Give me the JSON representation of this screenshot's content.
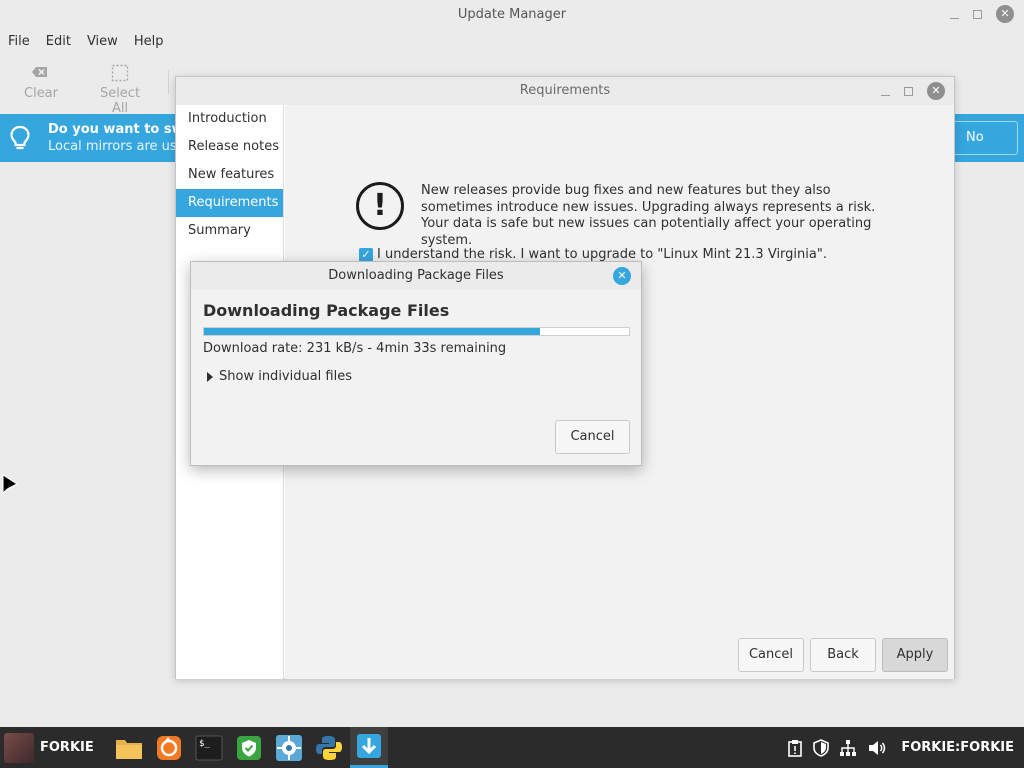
{
  "main_window": {
    "title": "Update Manager",
    "menu": [
      "File",
      "Edit",
      "View",
      "Help"
    ],
    "toolbar": {
      "clear_label": "Clear",
      "select_all_label": "Select All"
    },
    "infobar": {
      "title": "Do you want to switc",
      "subtitle": "Local mirrors are usua",
      "no_label": "No"
    }
  },
  "requirements_window": {
    "title": "Requirements",
    "sidebar": [
      "Introduction",
      "Release notes",
      "New features",
      "Requirements",
      "Summary"
    ],
    "active_sidebar_index": 3,
    "message": "New releases provide bug fixes and new features but they also sometimes introduce new issues. Upgrading always represents a risk. Your data is safe but new issues can potentially affect your operating system.",
    "checkbox_label": "I understand the risk. I want to upgrade to \"Linux Mint 21.3 Virginia\".",
    "checkbox_checked": true,
    "buttons": {
      "cancel": "Cancel",
      "back": "Back",
      "apply": "Apply"
    }
  },
  "download_dialog": {
    "title": "Downloading Package Files",
    "heading": "Downloading Package Files",
    "progress_fraction": 0.79,
    "rate_text": "Download rate: 231 kB/s - 4min 33s remaining",
    "expander_label": "Show individual files",
    "cancel_label": "Cancel"
  },
  "taskbar": {
    "menu_label": "FORKIE",
    "launchers": [
      "files-icon",
      "firefox-icon",
      "terminal-icon",
      "shield-app-icon",
      "network-app-icon",
      "python-icon",
      "update-manager-icon"
    ],
    "tray_label": "FORKIE:FORKIE"
  },
  "colors": {
    "accent": "#35a6de",
    "taskbar": "#2b2b2b",
    "window_bg": "#ebebeb"
  }
}
